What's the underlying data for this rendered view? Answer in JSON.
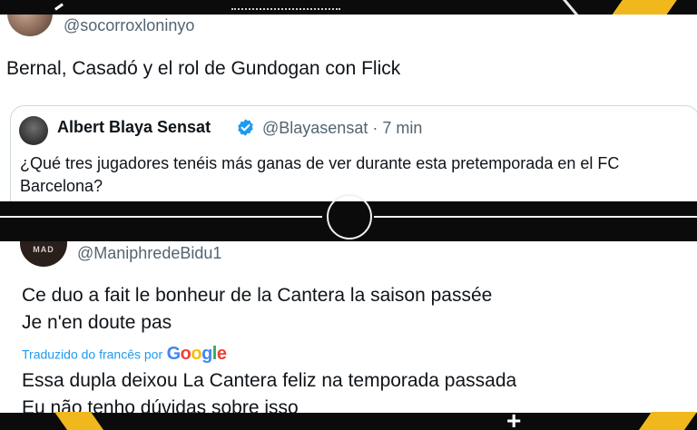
{
  "tweet_top": {
    "handle": "@socorroxloninyo",
    "text": "Bernal, Casadó y el rol de Gundogan con Flick",
    "quoted": {
      "name": "Albert Blaya Sensat",
      "handle_time": "@Blayasensat · 7 min",
      "text": "¿Qué tres jugadores tenéis más ganas de ver durante esta pretemporada en el FC Barcelona?"
    }
  },
  "tweet_bottom": {
    "avatar_text": "MAD",
    "handle": "@ManiphredeBidu1",
    "text_line1": "Ce duo a fait le bonheur de la Cantera la saison passée",
    "text_line2": "Je n'en doute pas",
    "translated_label": "Traduzido do francês por",
    "google_letters": [
      "G",
      "o",
      "o",
      "g",
      "l",
      "e"
    ],
    "translation_line1": "Essa dupla deixou La Cantera feliz na temporada passada",
    "translation_line2": "Eu não tenho dúvidas sobre isso"
  },
  "colors": {
    "text_primary": "#0f1419",
    "text_secondary": "#536471",
    "link_blue": "#1d9bf0",
    "verified_blue": "#1d9bf0",
    "accent_yellow": "#f1b81e",
    "google": [
      "#4285f4",
      "#ea4335",
      "#fbbc05",
      "#4285f4",
      "#34a853",
      "#ea4335"
    ]
  },
  "icons": {
    "verified": "verified-badge-icon"
  }
}
